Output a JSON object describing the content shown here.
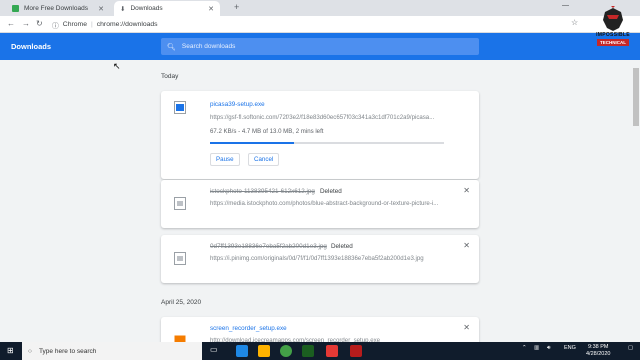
{
  "browser": {
    "tabs": [
      {
        "label": "More Free Downloads",
        "active": false,
        "icon": "green-download-favicon"
      },
      {
        "label": "Downloads",
        "active": true,
        "icon": "download-arrow-icon"
      }
    ],
    "omnibox": {
      "chip": "Chrome",
      "url": "chrome://downloads"
    }
  },
  "header": {
    "title": "Downloads",
    "search_placeholder": "Search downloads"
  },
  "watermark": {
    "line1": "IMPOSSIBLE",
    "line2": "TECHNICAL"
  },
  "groups": [
    {
      "date": "Today"
    },
    {
      "date": "April 25, 2020"
    }
  ],
  "downloads": [
    {
      "file_name": "picasa39-setup.exe",
      "url": "https://gsf-fl.softonic.com/72f/3e2/f18e83d60ec657f03c341a3c1df701c2a9/picasa...",
      "progress_text": "67.2 KB/s - 4.7 MB of 13.0 MB, 2 mins left",
      "progress_fraction": 0.36,
      "pause_label": "Pause",
      "cancel_label": "Cancel"
    },
    {
      "file_name": "istockphoto-1138395421-612x612.jpg",
      "status": "Deleted",
      "url": "https://media.istockphoto.com/photos/blue-abstract-background-or-texture-picture-i..."
    },
    {
      "file_name": "0d7ff1393e18836e7eba5f2ab200d1e3.jpg",
      "status": "Deleted",
      "url": "https://i.pinimg.com/originals/0d/7f/f1/0d7ff1393e18836e7eba5f2ab200d1e3.jpg"
    },
    {
      "file_name": "screen_recorder_setup.exe",
      "url": "http://download.icecreamapps.com/screen_recorder_setup.exe"
    }
  ],
  "taskbar": {
    "search_placeholder": "Type here to search",
    "language": "ENG",
    "time": "9:38 PM",
    "date": "4/28/2020"
  },
  "colors": {
    "accent": "#1a73e8",
    "header": "#1a73e8",
    "taskbar": "#101c2c"
  }
}
